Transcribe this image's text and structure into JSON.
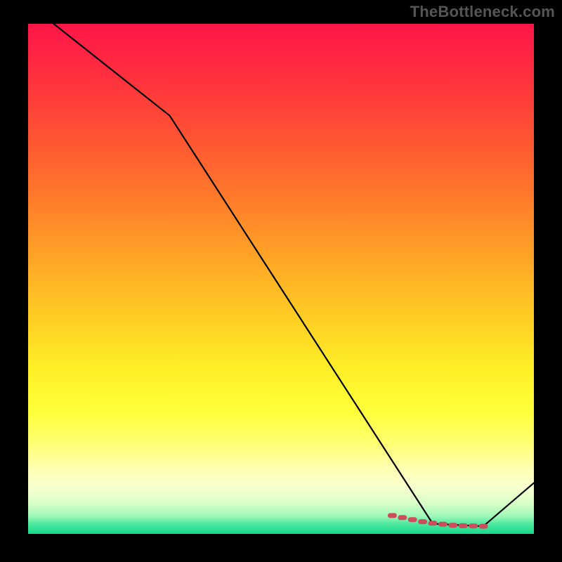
{
  "watermark": "TheBottleneck.com",
  "colors": {
    "background": "#000000",
    "line": "#000000",
    "marker": "#cc4e5c",
    "gradient_top": "#ff1648",
    "gradient_bottom": "#16d98c"
  },
  "chart_data": {
    "type": "line",
    "title": "",
    "xlabel": "",
    "ylabel": "",
    "xlim": [
      0,
      100
    ],
    "ylim": [
      0,
      100
    ],
    "x": [
      0,
      28,
      80,
      90,
      100
    ],
    "values": [
      104,
      82,
      2,
      1.5,
      10
    ],
    "markers": {
      "x": [
        72,
        74,
        76,
        78,
        80,
        82,
        84,
        86,
        88,
        90
      ],
      "values": [
        3.6,
        3.2,
        2.8,
        2.4,
        2.1,
        1.9,
        1.7,
        1.6,
        1.55,
        1.5
      ]
    },
    "note": "values are approximate readings from the un-axised gradient plot; 0 = bottom (green), 100 = top (red). Line starts above the visible frame (~104), kinks at x≈28, descends to a flat trough around x≈80–90, then rises."
  }
}
